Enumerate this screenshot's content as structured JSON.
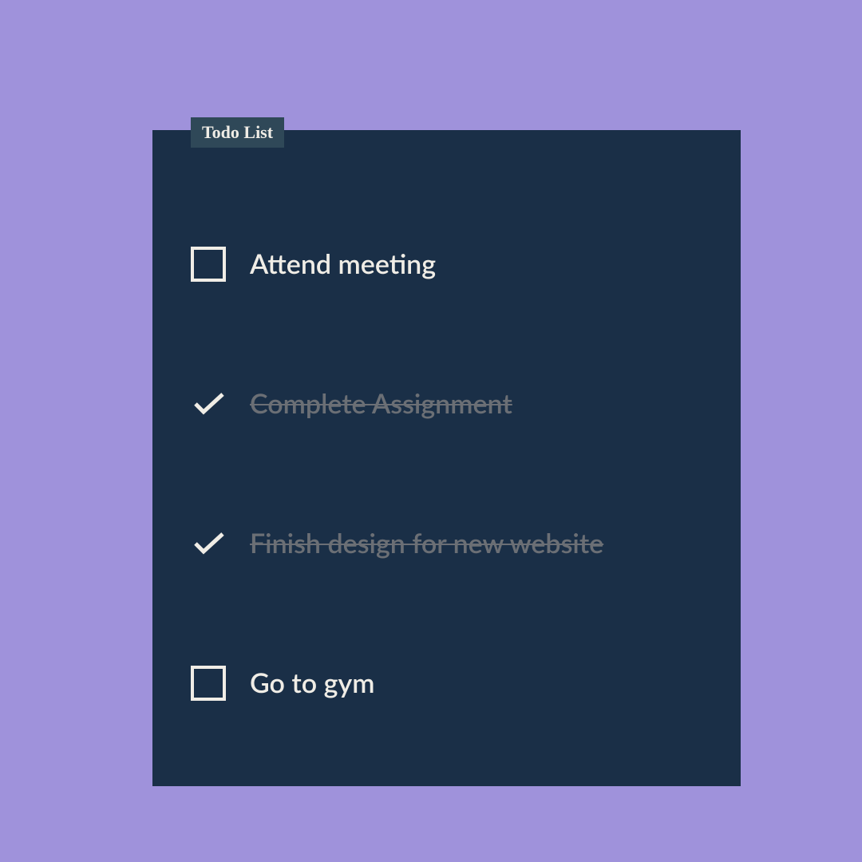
{
  "card": {
    "title": "Todo List",
    "items": [
      {
        "label": "Attend meeting",
        "done": false
      },
      {
        "label": "Complete Assignment",
        "done": true
      },
      {
        "label": "Finish design for new website",
        "done": true
      },
      {
        "label": "Go to gym",
        "done": false
      }
    ]
  }
}
